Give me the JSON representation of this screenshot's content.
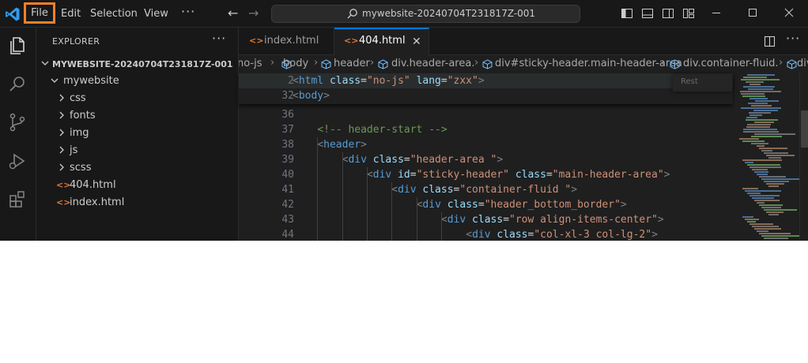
{
  "menu": {
    "file": "File",
    "edit": "Edit",
    "selection": "Selection",
    "view": "View",
    "more": "···"
  },
  "search": {
    "text": "mywebsite-20240704T231817Z-001"
  },
  "explorer": {
    "title": "EXPLORER",
    "more": "···",
    "root": "MYWEBSITE-20240704T231817Z-001",
    "folder": "mywebsite",
    "folders": [
      "css",
      "fonts",
      "img",
      "js",
      "scss"
    ],
    "files": [
      "404.html",
      "index.html"
    ],
    "file_icon": "<>"
  },
  "tabs": {
    "index": "index.html",
    "active": "404.html",
    "close": "✕",
    "more": "···"
  },
  "breadcrumbs": [
    "no-js",
    "body",
    "header",
    "div.header-area.",
    "div#sticky-header.main-header-area",
    "div.container-fluid.",
    "div"
  ],
  "find_widget": {
    "placeholder": "Rest"
  },
  "code": {
    "sticky": [
      {
        "ln": "2",
        "parts": [
          [
            "c-punc",
            "<"
          ],
          [
            "c-tag",
            "html"
          ],
          [
            "c-txt",
            " "
          ],
          [
            "c-attr",
            "class"
          ],
          [
            "c-txt",
            "="
          ],
          [
            "c-str",
            "\"no-js\""
          ],
          [
            "c-txt",
            " "
          ],
          [
            "c-attr",
            "lang"
          ],
          [
            "c-txt",
            "="
          ],
          [
            "c-str",
            "\"zxx\""
          ],
          [
            "c-punc",
            ">"
          ]
        ]
      },
      {
        "ln": "32",
        "parts": [
          [
            "c-punc",
            "<"
          ],
          [
            "c-tag",
            "body"
          ],
          [
            "c-punc",
            ">"
          ]
        ]
      }
    ],
    "lines": [
      {
        "ln": "36",
        "indent": 0,
        "parts": []
      },
      {
        "ln": "37",
        "indent": 4,
        "parts": [
          [
            "c-com",
            "<!-- header-start -->"
          ]
        ]
      },
      {
        "ln": "38",
        "indent": 4,
        "parts": [
          [
            "c-punc",
            "<"
          ],
          [
            "c-tag",
            "header"
          ],
          [
            "c-punc",
            ">"
          ]
        ]
      },
      {
        "ln": "39",
        "indent": 8,
        "parts": [
          [
            "c-punc",
            "<"
          ],
          [
            "c-tag",
            "div"
          ],
          [
            "c-txt",
            " "
          ],
          [
            "c-attr",
            "class"
          ],
          [
            "c-txt",
            "="
          ],
          [
            "c-str",
            "\"header-area \""
          ],
          [
            "c-punc",
            ">"
          ]
        ]
      },
      {
        "ln": "40",
        "indent": 12,
        "parts": [
          [
            "c-punc",
            "<"
          ],
          [
            "c-tag",
            "div"
          ],
          [
            "c-txt",
            " "
          ],
          [
            "c-attr",
            "id"
          ],
          [
            "c-txt",
            "="
          ],
          [
            "c-str",
            "\"sticky-header\""
          ],
          [
            "c-txt",
            " "
          ],
          [
            "c-attr",
            "class"
          ],
          [
            "c-txt",
            "="
          ],
          [
            "c-str",
            "\"main-header-area\""
          ],
          [
            "c-punc",
            ">"
          ]
        ]
      },
      {
        "ln": "41",
        "indent": 16,
        "parts": [
          [
            "c-punc",
            "<"
          ],
          [
            "c-tag",
            "div"
          ],
          [
            "c-txt",
            " "
          ],
          [
            "c-attr",
            "class"
          ],
          [
            "c-txt",
            "="
          ],
          [
            "c-str",
            "\"container-fluid \""
          ],
          [
            "c-punc",
            ">"
          ]
        ]
      },
      {
        "ln": "42",
        "indent": 20,
        "parts": [
          [
            "c-punc",
            "<"
          ],
          [
            "c-tag",
            "div"
          ],
          [
            "c-txt",
            " "
          ],
          [
            "c-attr",
            "class"
          ],
          [
            "c-txt",
            "="
          ],
          [
            "c-str",
            "\"header_bottom_border\""
          ],
          [
            "c-punc",
            ">"
          ]
        ]
      },
      {
        "ln": "43",
        "indent": 24,
        "parts": [
          [
            "c-punc",
            "<"
          ],
          [
            "c-tag",
            "div"
          ],
          [
            "c-txt",
            " "
          ],
          [
            "c-attr",
            "class"
          ],
          [
            "c-txt",
            "="
          ],
          [
            "c-str",
            "\"row align-items-center\""
          ],
          [
            "c-punc",
            ">"
          ]
        ]
      },
      {
        "ln": "44",
        "indent": 28,
        "parts": [
          [
            "c-punc",
            "<"
          ],
          [
            "c-tag",
            "div"
          ],
          [
            "c-txt",
            " "
          ],
          [
            "c-attr",
            "class"
          ],
          [
            "c-txt",
            "="
          ],
          [
            "c-str",
            "\"col-xl-3 col-lg-2\""
          ],
          [
            "c-punc",
            ">"
          ]
        ]
      }
    ]
  },
  "colors": {
    "accent": "#0078d4",
    "highlight_box": "#f0802c",
    "html_icon": "#e37933"
  },
  "icons": {
    "logo": "vscode-logo-icon",
    "back": "arrow-left-icon",
    "forward": "arrow-right-icon",
    "search": "search-icon"
  }
}
